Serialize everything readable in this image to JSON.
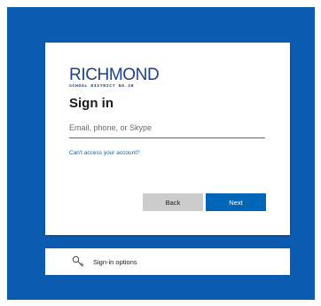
{
  "colors": {
    "background": "#0b5cb0",
    "brand": "#1d3f8f",
    "primary_button": "#0067b8",
    "secondary_button": "#cccccc",
    "link": "#0067b8"
  },
  "logo": {
    "name": "RICHMOND",
    "subtitle": "SCHOOL DISTRICT NO.38"
  },
  "signin": {
    "title": "Sign in",
    "email_placeholder": "Email, phone, or Skype",
    "email_value": "",
    "access_link": "Can't access your account?",
    "back_label": "Back",
    "next_label": "Next"
  },
  "options": {
    "icon": "key-icon",
    "label": "Sign-in options"
  }
}
